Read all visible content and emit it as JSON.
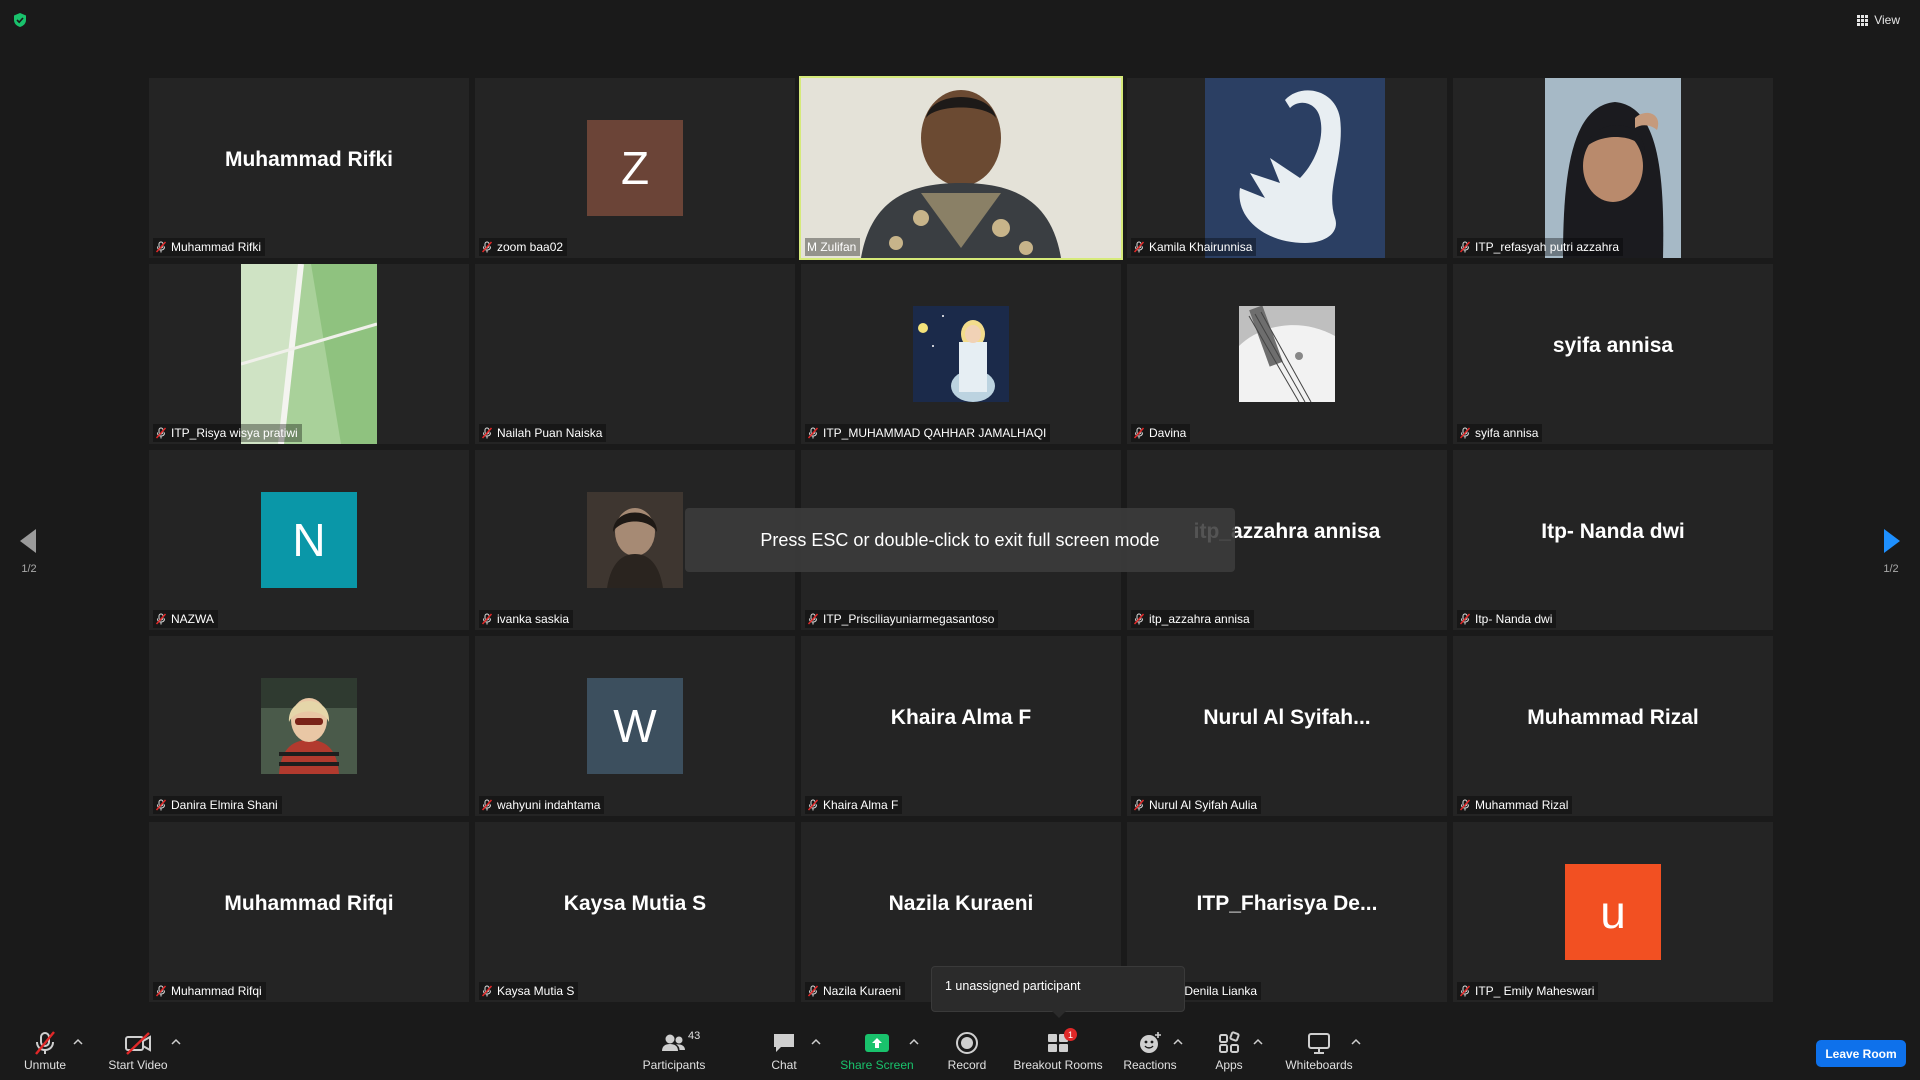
{
  "top": {
    "view_label": "View"
  },
  "toast": {
    "text": "Press ESC or double-click to exit full screen mode"
  },
  "unassigned": {
    "text": "1 unassigned participant"
  },
  "pages": {
    "left": "1/2",
    "right": "1/2"
  },
  "tiles": [
    {
      "label": "Muhammad Rifki",
      "display": "Muhammad Rifki",
      "kind": "name"
    },
    {
      "label": "zoom baa02",
      "display": "Z",
      "kind": "avatar",
      "color": "#6b4437"
    },
    {
      "label": "M Zulifan",
      "display": "",
      "kind": "video",
      "active": true
    },
    {
      "label": "Kamila Khairunnisa",
      "display": "",
      "kind": "photo-swan"
    },
    {
      "label": "ITP_refasyah putri azzahra",
      "display": "",
      "kind": "photo-person"
    },
    {
      "label": "ITP_Risya wisya pratiwi",
      "display": "",
      "kind": "photo-room"
    },
    {
      "label": "Nailah Puan Naiska",
      "display": "",
      "kind": "blank"
    },
    {
      "label": "ITP_MUHAMMAD QAHHAR JAMALHAQI",
      "display": "",
      "kind": "thumb-night"
    },
    {
      "label": "Davina",
      "display": "",
      "kind": "thumb-guitar"
    },
    {
      "label": "syifa annisa",
      "display": "syifa annisa",
      "kind": "name"
    },
    {
      "label": "NAZWA",
      "display": "N",
      "kind": "avatar",
      "color": "#0a97a8"
    },
    {
      "label": "ivanka saskia",
      "display": "",
      "kind": "thumb-dark"
    },
    {
      "label": "ITP_Prisciliayuniarmegasantoso",
      "display": "",
      "kind": "blank"
    },
    {
      "label": "itp_azzahra annisa",
      "display": "itp_azzahra annisa",
      "kind": "name"
    },
    {
      "label": "Itp- Nanda dwi",
      "display": "Itp- Nanda dwi",
      "kind": "name"
    },
    {
      "label": "Danira Elmira Shani",
      "display": "",
      "kind": "thumb-girl"
    },
    {
      "label": "wahyuni indahtama",
      "display": "W",
      "kind": "avatar",
      "color": "#3c4f5e"
    },
    {
      "label": "Khaira Alma F",
      "display": "Khaira Alma F",
      "kind": "name"
    },
    {
      "label": "Nurul Al Syifah Aulia",
      "display": "Nurul  Al  Syifah...",
      "kind": "name"
    },
    {
      "label": "Muhammad Rizal",
      "display": "Muhammad Rizal",
      "kind": "name"
    },
    {
      "label": "Muhammad Rifqi",
      "display": "Muhammad Rifqi",
      "kind": "name"
    },
    {
      "label": "Kaysa Mutia S",
      "display": "Kaysa Mutia S",
      "kind": "name"
    },
    {
      "label": "Nazila Kuraeni",
      "display": "Nazila Kuraeni",
      "kind": "name"
    },
    {
      "label": "arisya Denila Lianka",
      "display": "ITP_Fharisya  De...",
      "kind": "name"
    },
    {
      "label": "ITP_ Emily Maheswari",
      "display": "u",
      "kind": "avatar",
      "color": "#f25022"
    }
  ],
  "toolbar": {
    "unmute": "Unmute",
    "start_video": "Start Video",
    "participants": "Participants",
    "participants_count": "43",
    "chat": "Chat",
    "share_screen": "Share Screen",
    "record": "Record",
    "breakout_rooms": "Breakout Rooms",
    "breakout_badge": "1",
    "reactions": "Reactions",
    "apps": "Apps",
    "whiteboards": "Whiteboards",
    "leave": "Leave Room"
  }
}
